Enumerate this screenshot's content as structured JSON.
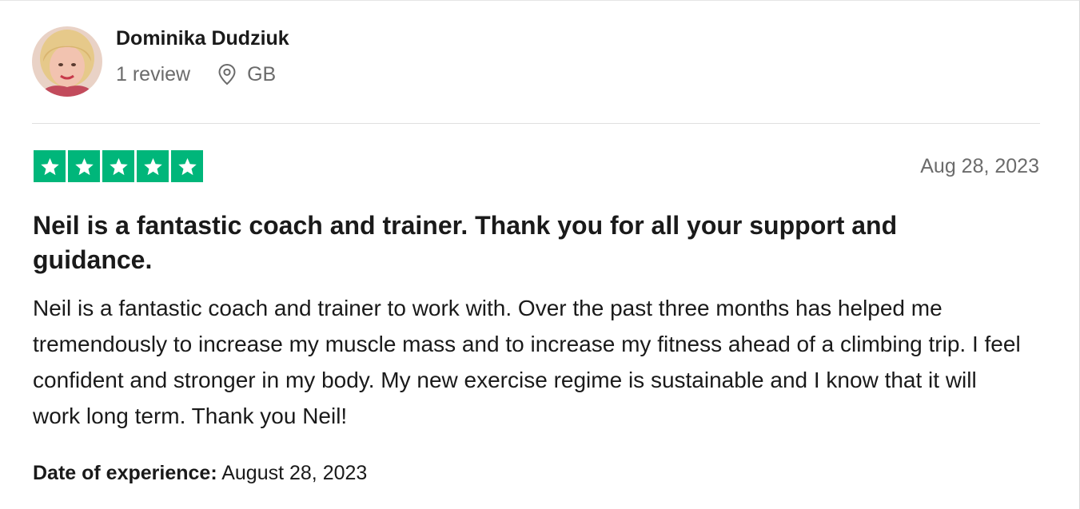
{
  "reviewer": {
    "name": "Dominika Dudziuk",
    "review_count": "1 review",
    "country": "GB",
    "avatar_icon": "profile-photo"
  },
  "review": {
    "rating": 5,
    "rating_max": 5,
    "star_color": "#00b67a",
    "date": "Aug 28, 2023",
    "title": "Neil is a fantastic coach and trainer. Thank you for all your support and guidance.",
    "body": "Neil is a fantastic coach and trainer to work with. Over the past three months has helped me tremendously to increase my muscle mass and to increase my fitness ahead of a climbing trip. I feel confident and stronger in my body. My new exercise regime is sustainable and I know that it will work long term. Thank you Neil!",
    "experience_label": "Date of experience:",
    "experience_date": "August 28, 2023"
  }
}
